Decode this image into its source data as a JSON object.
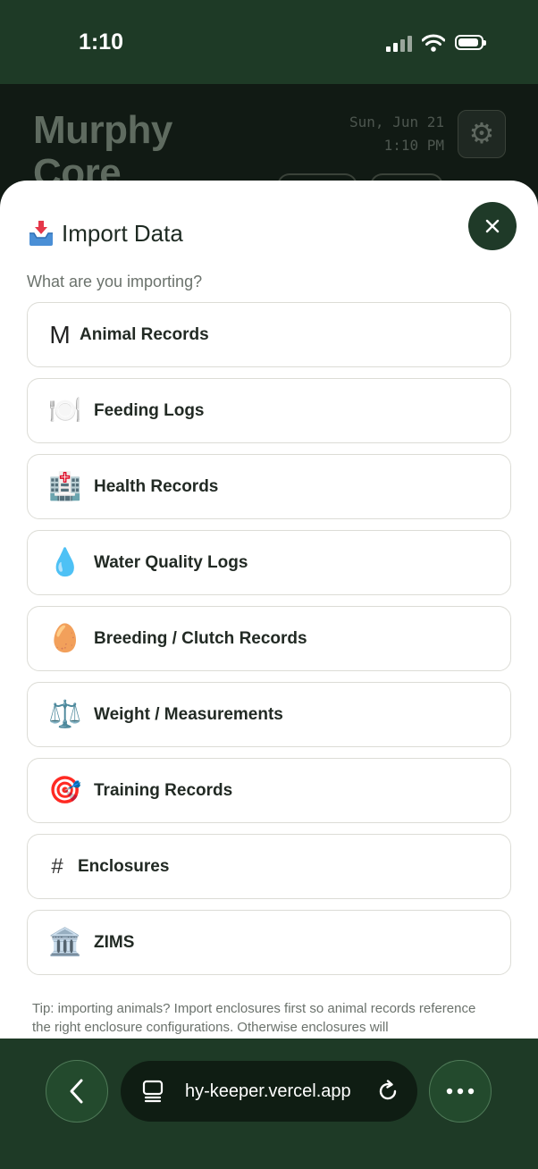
{
  "status_bar": {
    "time": "1:10",
    "signal_bars": 2
  },
  "app": {
    "title_line1": "Murphy",
    "title_line2": "Core",
    "date": "Sun, Jun 21",
    "time": "1:10 PM"
  },
  "modal": {
    "title": "Import Data",
    "prompt": "What are you importing?",
    "options": [
      {
        "icon": "letter-m-icon",
        "glyph": "M",
        "label": "Animal Records"
      },
      {
        "icon": "plate-cutlery-icon",
        "glyph": "🍽️",
        "label": "Feeding Logs"
      },
      {
        "icon": "hospital-icon",
        "glyph": "🏥",
        "label": "Health Records"
      },
      {
        "icon": "water-drop-icon",
        "glyph": "💧",
        "label": "Water Quality Logs"
      },
      {
        "icon": "egg-icon",
        "glyph": "🥚",
        "label": "Breeding / Clutch Records"
      },
      {
        "icon": "scales-icon",
        "glyph": "⚖️",
        "label": "Weight / Measurements"
      },
      {
        "icon": "target-icon",
        "glyph": "🎯",
        "label": "Training Records"
      },
      {
        "icon": "hash-icon",
        "glyph": "#",
        "label": "Enclosures"
      },
      {
        "icon": "classical-building-icon",
        "glyph": "🏛️",
        "label": "ZIMS"
      }
    ],
    "tip": "Tip: importing animals? Import enclosures first so animal records reference the right enclosure configurations. Otherwise enclosures will"
  },
  "browser": {
    "url": "hy-keeper.vercel.app"
  },
  "colors": {
    "brand_dark": "#1e3a26",
    "close_button": "#1f3a28",
    "sheet_bg": "#ffffff"
  }
}
